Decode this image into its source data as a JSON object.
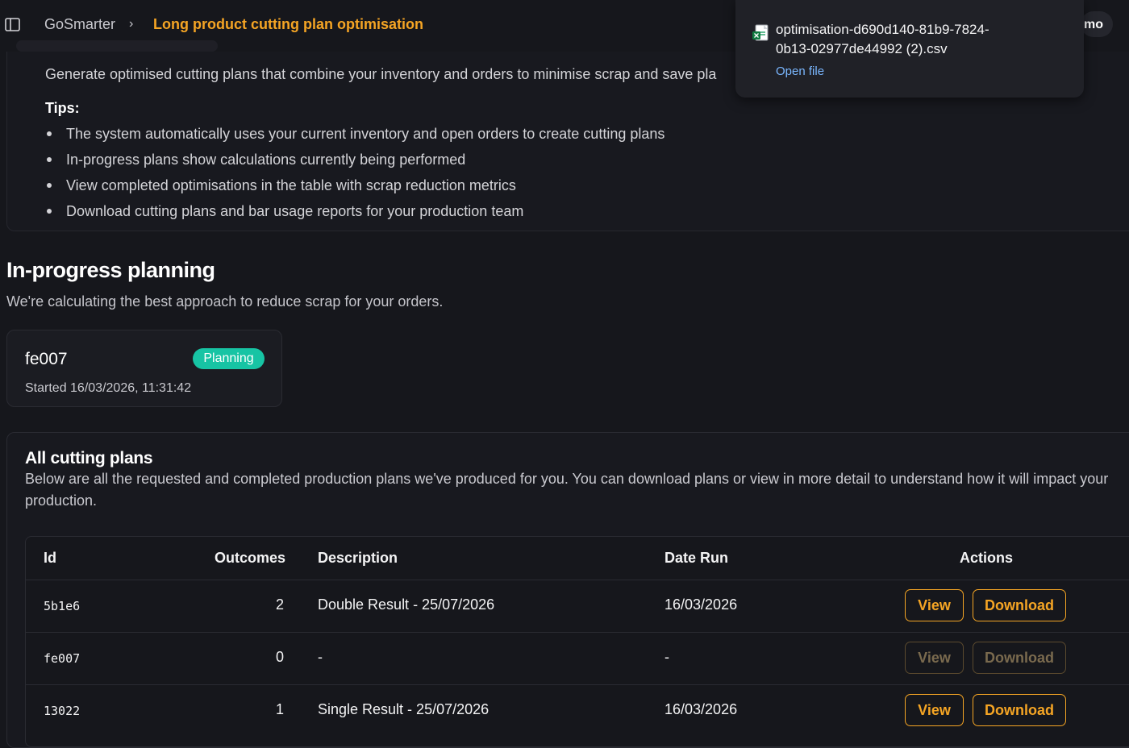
{
  "header": {
    "breadcrumb_root": "GoSmarter",
    "breadcrumb_separator": "›",
    "breadcrumb_current": "Long product cutting plan optimisation",
    "user_label": "mo"
  },
  "info": {
    "intro": "Generate optimised cutting plans that combine your inventory and orders to minimise scrap and save pla",
    "tips_title": "Tips:",
    "tips": [
      "The system automatically uses your current inventory and open orders to create cutting plans",
      "In-progress plans show calculations currently being performed",
      "View completed optimisations in the table with scrap reduction metrics",
      "Download cutting plans and bar usage reports for your production team"
    ]
  },
  "in_progress": {
    "title": "In-progress planning",
    "subtitle": "We're calculating the best approach to reduce scrap for your orders.",
    "card": {
      "id": "fe007",
      "status": "Planning",
      "status_color": "#17c4a4",
      "started": "Started 16/03/2026, 11:31:42"
    }
  },
  "all_plans": {
    "title": "All cutting plans",
    "description": "Below are all the requested and completed production plans we've produced for you. You can download plans or view in more detail to understand how it will impact your production.",
    "columns": [
      "Id",
      "Outcomes",
      "Description",
      "Date Run",
      "Actions"
    ],
    "rows": [
      {
        "id": "5b1e6",
        "outcomes": "2",
        "description": "Double Result - 25/07/2026",
        "date_run": "16/03/2026",
        "view": "View",
        "download": "Download",
        "enabled": true
      },
      {
        "id": "fe007",
        "outcomes": "0",
        "description": "-",
        "date_run": "-",
        "view": "View",
        "download": "Download",
        "enabled": false
      },
      {
        "id": "13022",
        "outcomes": "1",
        "description": "Single Result - 25/07/2026",
        "date_run": "16/03/2026",
        "view": "View",
        "download": "Download",
        "enabled": true
      }
    ]
  },
  "download_toast": {
    "filename": "optimisation-d690d140-81b9-7824-0b13-02977de44992 (2).csv",
    "action": "Open file",
    "icon": "excel-file-icon"
  },
  "colors": {
    "accent": "#f5a524",
    "background": "#16171c",
    "badge": "#17c4a4",
    "link": "#7ab7ff"
  }
}
